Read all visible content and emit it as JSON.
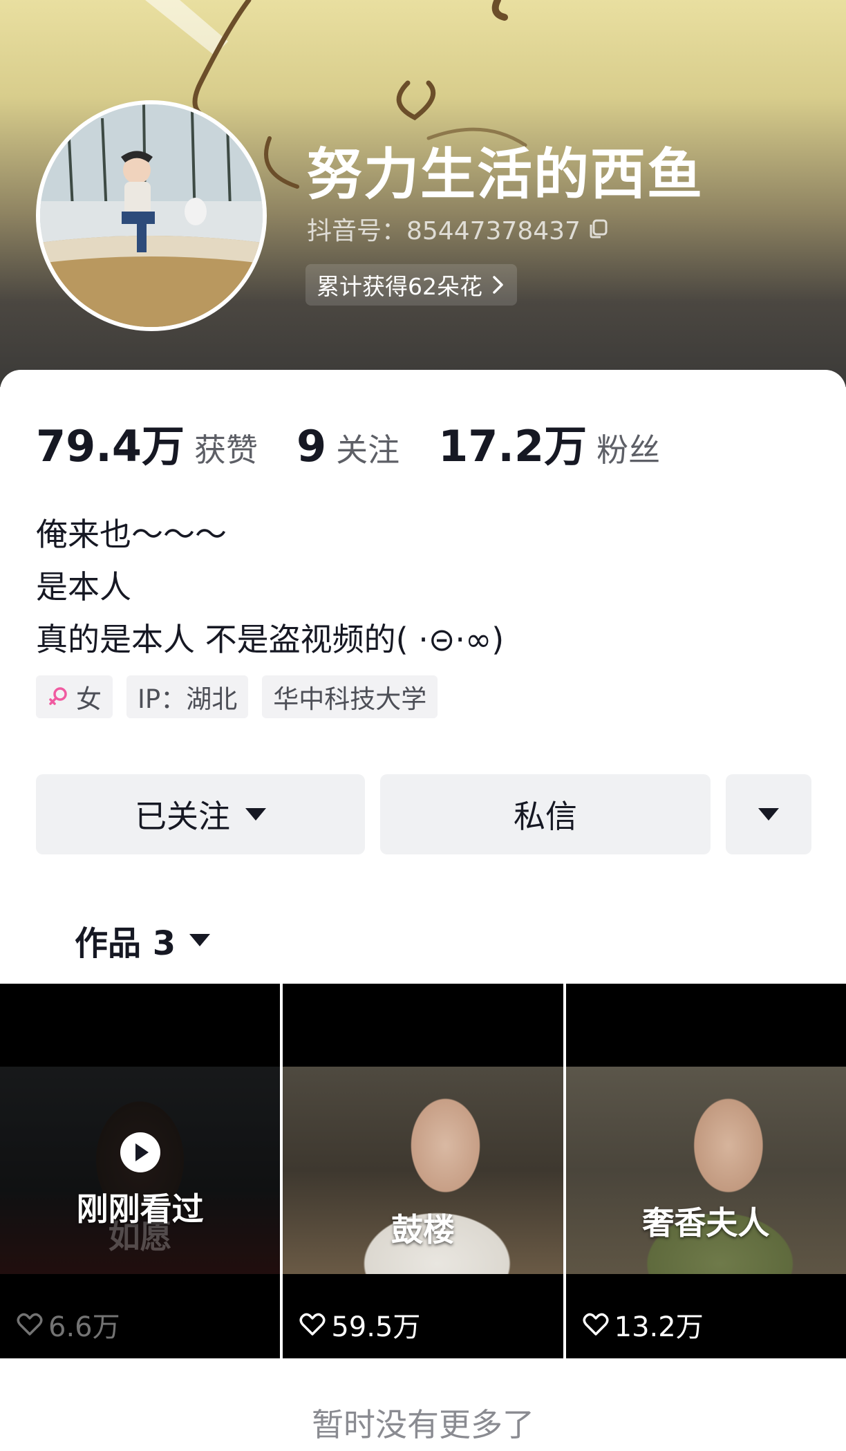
{
  "profile": {
    "name": "努力生活的西鱼",
    "douyin_id": "抖音号：85447378437",
    "flowers": "累计获得62朵花"
  },
  "stats": {
    "likes_num": "79.4万",
    "likes_label": "获赞",
    "following_num": "9",
    "following_label": "关注",
    "fans_num": "17.2万",
    "fans_label": "粉丝"
  },
  "bio": {
    "line1": "俺来也～～～",
    "line2": "是本人",
    "line3": "真的是本人 不是盗视频的( ·⊝·∞)"
  },
  "tags": {
    "gender": "女",
    "ip": "IP：湖北",
    "school": "华中科技大学"
  },
  "actions": {
    "followed": "已关注",
    "message": "私信"
  },
  "works_tab": {
    "label": "作品 3"
  },
  "videos": [
    {
      "status": "刚刚看过",
      "title": "如愿",
      "likes": "6.6万"
    },
    {
      "title": "鼓楼",
      "likes": "59.5万"
    },
    {
      "title": "奢香夫人",
      "likes": "13.2万"
    }
  ],
  "footer": {
    "text": "暂时没有更多了"
  },
  "colors": {
    "gender_icon": "#f05aa0",
    "text_primary": "#161823"
  }
}
